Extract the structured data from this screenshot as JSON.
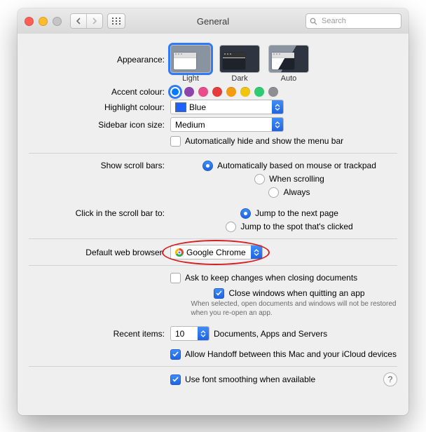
{
  "titlebar": {
    "title": "General",
    "search_placeholder": "Search"
  },
  "appearance": {
    "label": "Appearance:",
    "options": [
      "Light",
      "Dark",
      "Auto"
    ],
    "selected": "Light"
  },
  "accent": {
    "label": "Accent colour:",
    "colors": [
      "#007aff",
      "#8e44ad",
      "#e94b8b",
      "#e73c3c",
      "#f39c12",
      "#f1c40f",
      "#2ecc71",
      "#8e8e93"
    ],
    "selected_index": 0
  },
  "highlight": {
    "label": "Highlight colour:",
    "value": "Blue"
  },
  "sidebar_size": {
    "label": "Sidebar icon size:",
    "value": "Medium"
  },
  "menubar": {
    "auto_hide": "Automatically hide and show the menu bar",
    "auto_hide_checked": false
  },
  "scrollbars": {
    "label": "Show scroll bars:",
    "options": [
      "Automatically based on mouse or trackpad",
      "When scrolling",
      "Always"
    ],
    "selected_index": 0
  },
  "scrollclick": {
    "label": "Click in the scroll bar to:",
    "options": [
      "Jump to the next page",
      "Jump to the spot that's clicked"
    ],
    "selected_index": 0
  },
  "default_browser": {
    "label": "Default web browser:",
    "value": "Google Chrome"
  },
  "documents": {
    "ask_keep_changes": "Ask to keep changes when closing documents",
    "ask_keep_changes_checked": false,
    "close_on_quit": "Close windows when quitting an app",
    "close_on_quit_checked": true,
    "close_on_quit_hint": "When selected, open documents and windows will not be restored when you re-open an app."
  },
  "recent": {
    "label": "Recent items:",
    "value": "10",
    "suffix": "Documents, Apps and Servers"
  },
  "handoff": {
    "label": "Allow Handoff between this Mac and your iCloud devices",
    "checked": true
  },
  "font_smoothing": {
    "label": "Use font smoothing when available",
    "checked": true
  }
}
